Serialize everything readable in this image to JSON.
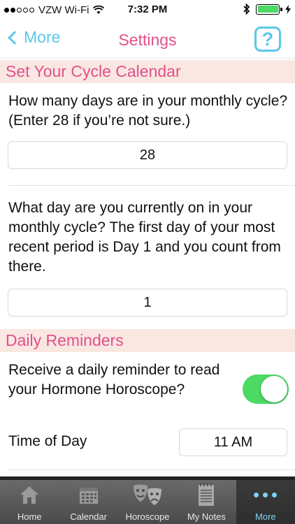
{
  "status": {
    "carrier": "VZW Wi-Fi",
    "time": "7:32 PM"
  },
  "nav": {
    "back_label": "More",
    "title": "Settings",
    "help_glyph": "?"
  },
  "cycle": {
    "header": "Set Your Cycle Calendar",
    "q1": "How many days are in your monthly cycle? (Enter 28 if you’re not sure.)",
    "q1_value": "28",
    "q2": "What day are you currently on in your monthly cycle? The first day of your most recent period is Day 1 and you count from there.",
    "q2_value": "1"
  },
  "reminders": {
    "header": "Daily Reminders",
    "toggle_label": "Receive a daily reminder to read your Hormone Horoscope?",
    "toggle_on": true,
    "time_label": "Time of Day",
    "time_value": "11 AM"
  },
  "tabs": [
    {
      "label": "Home",
      "icon": "home-icon"
    },
    {
      "label": "Calendar",
      "icon": "calendar-icon"
    },
    {
      "label": "Horoscope",
      "icon": "masks-icon"
    },
    {
      "label": "My Notes",
      "icon": "notepad-icon"
    },
    {
      "label": "More",
      "icon": "more-icon"
    }
  ],
  "colors": {
    "accent_pink": "#e0508a",
    "accent_blue": "#5ac8e8",
    "section_bg": "#fbe7e2",
    "toggle_on": "#4cd964"
  }
}
